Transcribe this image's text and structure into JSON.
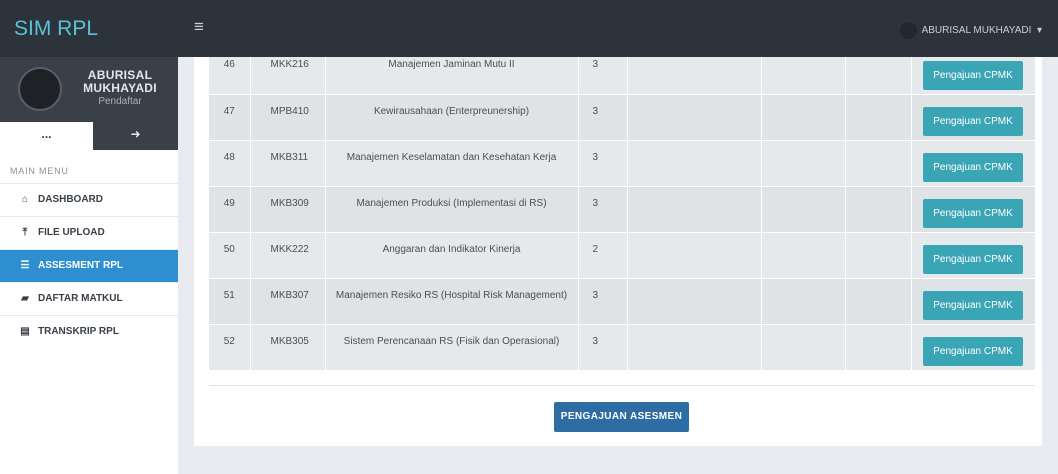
{
  "sidebar": {
    "brand": "SIM RPL",
    "user": {
      "name": "ABURISAL MUKHAYADI",
      "role": "Pendaftar"
    },
    "tabs": [
      "...",
      "➜"
    ],
    "menu_header": "MAIN MENU",
    "items": [
      {
        "label": "DASHBOARD",
        "icon": "⌂"
      },
      {
        "label": "FILE UPLOAD",
        "icon": "⤒"
      },
      {
        "label": "ASSESMENT RPL",
        "icon": "☰"
      },
      {
        "label": "DAFTAR MATKUL",
        "icon": "▰"
      },
      {
        "label": "TRANSKRIP RPL",
        "icon": "▤"
      }
    ],
    "active_index": 2
  },
  "navbar": {
    "toggle_icon": "≡",
    "user_label": "ABURISAL MUKHAYADI",
    "caret": "▾"
  },
  "table": {
    "rows": [
      {
        "no": "46",
        "code": "MKK216",
        "name": "Manajemen Jaminan Mutu II",
        "sks": "3",
        "action": "Pengajuan CPMK"
      },
      {
        "no": "47",
        "code": "MPB410",
        "name": "Kewirausahaan (Enterpreunership)",
        "sks": "3",
        "action": "Pengajuan CPMK"
      },
      {
        "no": "48",
        "code": "MKB311",
        "name": "Manajemen Keselamatan dan Kesehatan Kerja",
        "sks": "3",
        "action": "Pengajuan CPMK"
      },
      {
        "no": "49",
        "code": "MKB309",
        "name": "Manajemen Produksi (Implementasi di RS)",
        "sks": "3",
        "action": "Pengajuan CPMK"
      },
      {
        "no": "50",
        "code": "MKK222",
        "name": "Anggaran dan Indikator Kinerja",
        "sks": "2",
        "action": "Pengajuan CPMK"
      },
      {
        "no": "51",
        "code": "MKB307",
        "name": "Manajemen Resiko RS (Hospital Risk Management)",
        "sks": "3",
        "action": "Pengajuan CPMK"
      },
      {
        "no": "52",
        "code": "MKB305",
        "name": "Sistem Perencanaan RS (Fisik dan Operasional)",
        "sks": "3",
        "action": "Pengajuan CPMK"
      }
    ]
  },
  "submit_label": "PENGAJUAN ASESMEN",
  "colors": {
    "navbar_bg": "#2d333b",
    "brand_text": "#5cc1d6",
    "active_menu": "#2e8fd0",
    "cpmk_button": "#3aa5b5",
    "submit_button": "#2e6da4"
  }
}
